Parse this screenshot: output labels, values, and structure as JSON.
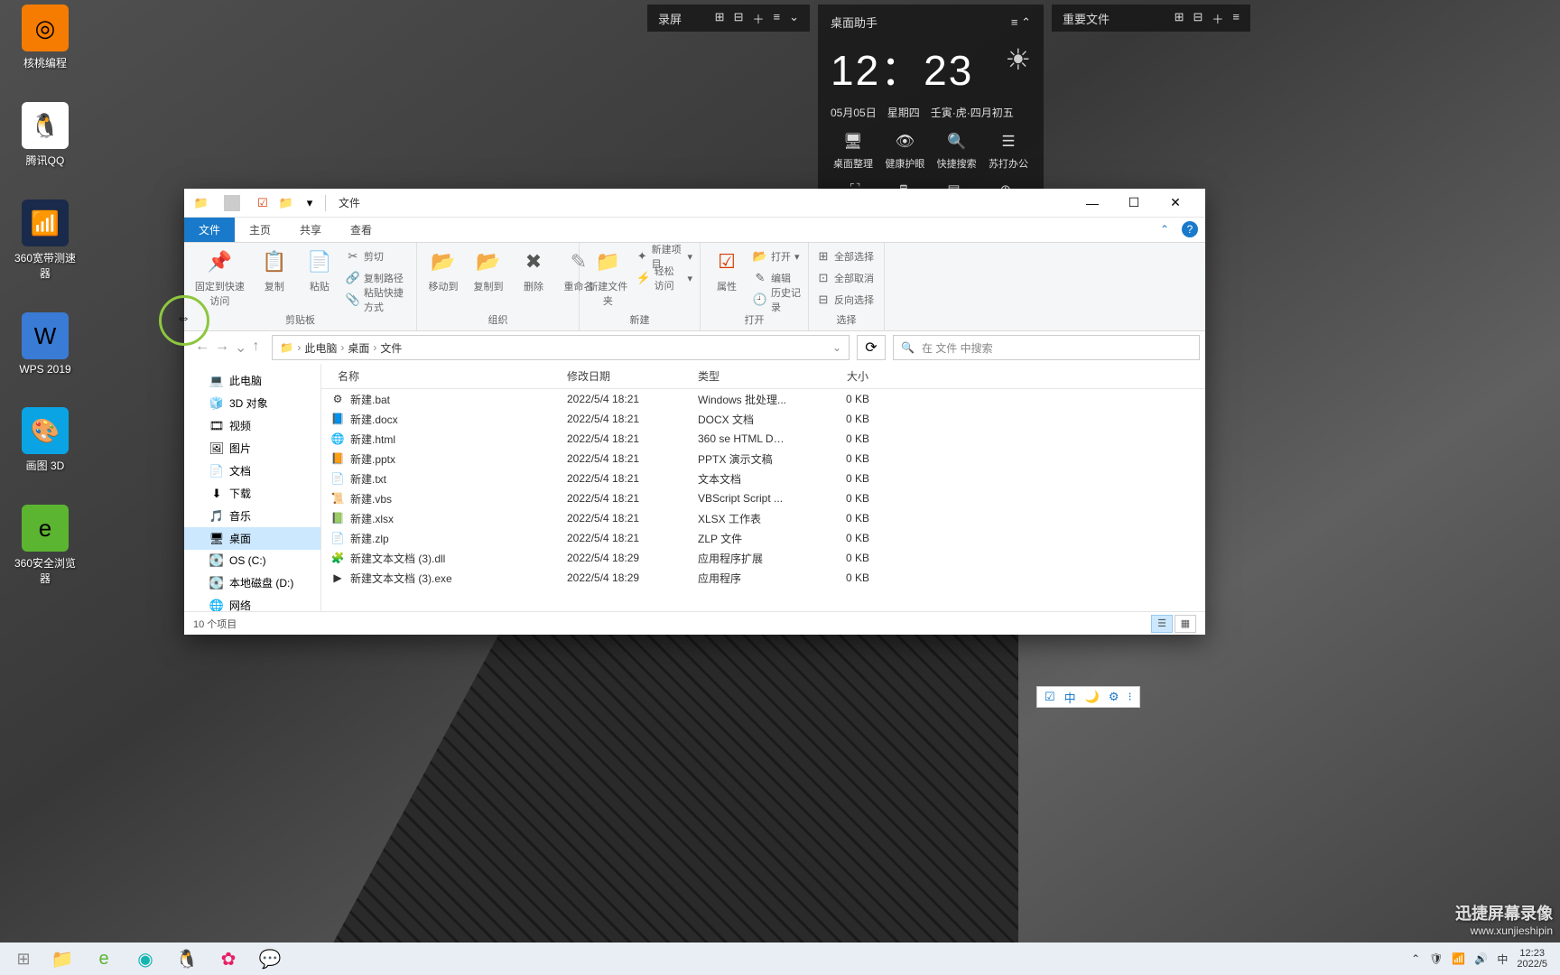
{
  "desktop_icons": [
    {
      "label": "核桃编程",
      "bg": "#f57c00",
      "glyph": "◎"
    },
    {
      "label": "腾讯QQ",
      "bg": "#ffffff",
      "glyph": "🐧"
    },
    {
      "label": "360宽带测速器",
      "bg": "#1a2a4a",
      "glyph": "📶"
    },
    {
      "label": "WPS 2019",
      "bg": "#3a7bd5",
      "glyph": "W"
    },
    {
      "label": "画图 3D",
      "bg": "#0aa4e4",
      "glyph": "🎨"
    },
    {
      "label": "360安全浏览器",
      "bg": "#5cb531",
      "glyph": "e"
    }
  ],
  "widget_rec": {
    "title": "录屏"
  },
  "widget_assist": {
    "title": "桌面助手",
    "time": "12：23",
    "date": "05月05日",
    "weekday": "星期四",
    "lunar": "壬寅·虎·四月初五",
    "tools": [
      "桌面整理",
      "健康护眼",
      "快捷搜索",
      "苏打办公"
    ]
  },
  "widget_files": {
    "title": "重要文件"
  },
  "explorer": {
    "title": "文件",
    "tabs": [
      "文件",
      "主页",
      "共享",
      "查看"
    ],
    "ribbon": {
      "pin": "固定到快速访问",
      "copy": "复制",
      "paste": "粘贴",
      "cut": "剪切",
      "copypath": "复制路径",
      "pasteshortcut": "粘贴快捷方式",
      "grp_clipboard": "剪贴板",
      "moveto": "移动到",
      "copyto": "复制到",
      "delete": "删除",
      "rename": "重命名",
      "grp_org": "组织",
      "newfolder": "新建文件夹",
      "newitem": "新建项目",
      "easyaccess": "轻松访问",
      "grp_new": "新建",
      "properties": "属性",
      "open": "打开",
      "edit": "编辑",
      "history": "历史记录",
      "grp_open": "打开",
      "selectall": "全部选择",
      "selectnone": "全部取消",
      "invertsel": "反向选择",
      "grp_select": "选择"
    },
    "breadcrumb": [
      "此电脑",
      "桌面",
      "文件"
    ],
    "search_placeholder": "在 文件 中搜索",
    "nav": [
      {
        "label": "此电脑",
        "glyph": "💻"
      },
      {
        "label": "3D 对象",
        "glyph": "🧊"
      },
      {
        "label": "视频",
        "glyph": "🎞"
      },
      {
        "label": "图片",
        "glyph": "🖼"
      },
      {
        "label": "文档",
        "glyph": "📄"
      },
      {
        "label": "下载",
        "glyph": "⬇"
      },
      {
        "label": "音乐",
        "glyph": "🎵"
      },
      {
        "label": "桌面",
        "glyph": "🖥",
        "active": true
      },
      {
        "label": "OS (C:)",
        "glyph": "💽"
      },
      {
        "label": "本地磁盘 (D:)",
        "glyph": "💽"
      },
      {
        "label": "网络",
        "glyph": "🌐"
      }
    ],
    "cols": {
      "name": "名称",
      "date": "修改日期",
      "type": "类型",
      "size": "大小"
    },
    "files": [
      {
        "name": "新建.bat",
        "date": "2022/5/4 18:21",
        "type": "Windows 批处理...",
        "size": "0 KB",
        "glyph": "⚙"
      },
      {
        "name": "新建.docx",
        "date": "2022/5/4 18:21",
        "type": "DOCX 文档",
        "size": "0 KB",
        "glyph": "📘"
      },
      {
        "name": "新建.html",
        "date": "2022/5/4 18:21",
        "type": "360 se HTML Do...",
        "size": "0 KB",
        "glyph": "🌐"
      },
      {
        "name": "新建.pptx",
        "date": "2022/5/4 18:21",
        "type": "PPTX 演示文稿",
        "size": "0 KB",
        "glyph": "📙"
      },
      {
        "name": "新建.txt",
        "date": "2022/5/4 18:21",
        "type": "文本文档",
        "size": "0 KB",
        "glyph": "📄"
      },
      {
        "name": "新建.vbs",
        "date": "2022/5/4 18:21",
        "type": "VBScript Script ...",
        "size": "0 KB",
        "glyph": "📜"
      },
      {
        "name": "新建.xlsx",
        "date": "2022/5/4 18:21",
        "type": "XLSX 工作表",
        "size": "0 KB",
        "glyph": "📗"
      },
      {
        "name": "新建.zlp",
        "date": "2022/5/4 18:21",
        "type": "ZLP 文件",
        "size": "0 KB",
        "glyph": "📄"
      },
      {
        "name": "新建文本文档 (3).dll",
        "date": "2022/5/4 18:29",
        "type": "应用程序扩展",
        "size": "0 KB",
        "glyph": "🧩"
      },
      {
        "name": "新建文本文档 (3).exe",
        "date": "2022/5/4 18:29",
        "type": "应用程序",
        "size": "0 KB",
        "glyph": "▶"
      }
    ],
    "status": "10 个项目"
  },
  "watermark": {
    "line1": "迅捷屏幕录像",
    "line2": "www.xunjieshipin"
  },
  "taskbar": {
    "time": "12:23",
    "date": "2022/5",
    "ime": "中"
  }
}
